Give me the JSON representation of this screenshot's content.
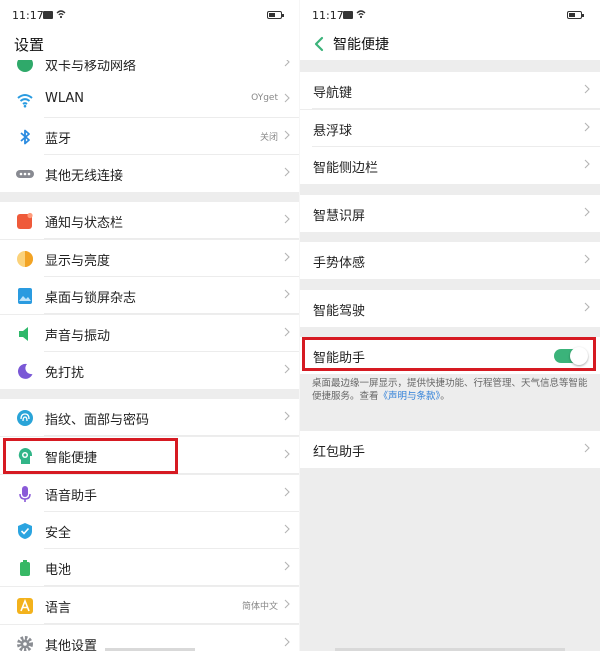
{
  "status": {
    "time": "11:17"
  },
  "left": {
    "title": "设置",
    "items": [
      {
        "label": "双卡与移动网络",
        "value": "",
        "icon": "sim-card-icon",
        "color": "#2fa96a"
      },
      {
        "label": "WLAN",
        "value": "OYget",
        "icon": "wifi-icon",
        "color": "#2a9be0"
      },
      {
        "label": "蓝牙",
        "value": "关闭",
        "icon": "bluetooth-icon",
        "color": "#2a8be0"
      },
      {
        "label": "其他无线连接",
        "value": "",
        "icon": "more-dots-icon",
        "color": "#888a91"
      },
      {
        "label": "通知与状态栏",
        "value": "",
        "icon": "notification-icon",
        "color": "#ef5a3a"
      },
      {
        "label": "显示与亮度",
        "value": "",
        "icon": "brightness-icon",
        "color": "#f2a324"
      },
      {
        "label": "桌面与锁屏杂志",
        "value": "",
        "icon": "wallpaper-icon",
        "color": "#2a9be0"
      },
      {
        "label": "声音与振动",
        "value": "",
        "icon": "speaker-icon",
        "color": "#2fb86a"
      },
      {
        "label": "免打扰",
        "value": "",
        "icon": "moon-icon",
        "color": "#7a58d6"
      },
      {
        "label": "指纹、面部与密码",
        "value": "",
        "icon": "fingerprint-icon",
        "color": "#2aa4d8"
      },
      {
        "label": "智能便捷",
        "value": "",
        "icon": "smart-assist-icon",
        "color": "#32b588"
      },
      {
        "label": "语音助手",
        "value": "",
        "icon": "microphone-icon",
        "color": "#8a5ad8"
      },
      {
        "label": "安全",
        "value": "",
        "icon": "shield-icon",
        "color": "#2aa4e0"
      },
      {
        "label": "电池",
        "value": "",
        "icon": "battery-icon",
        "color": "#37b865"
      },
      {
        "label": "语言",
        "value": "简体中文",
        "icon": "language-icon",
        "color": "#f3b21c"
      },
      {
        "label": "其他设置",
        "value": "",
        "icon": "gear-icon",
        "color": "#8a8d93"
      }
    ]
  },
  "right": {
    "title": "智能便捷",
    "items": [
      {
        "label": "导航键"
      },
      {
        "label": "悬浮球"
      },
      {
        "label": "智能侧边栏"
      },
      {
        "label": "智慧识屏"
      },
      {
        "label": "手势体感"
      },
      {
        "label": "智能驾驶"
      },
      {
        "label": "智能助手",
        "toggle": true
      },
      {
        "label": "红包助手"
      }
    ],
    "assistant_desc": "桌面最边缘一屏显示，提供快捷功能、行程管理、天气信息等智能便捷服务。查看",
    "assistant_link": "《声明与条款》",
    "assistant_desc_end": "。",
    "accent_color": "#3bb37a",
    "highlight_color": "#d61a22"
  }
}
